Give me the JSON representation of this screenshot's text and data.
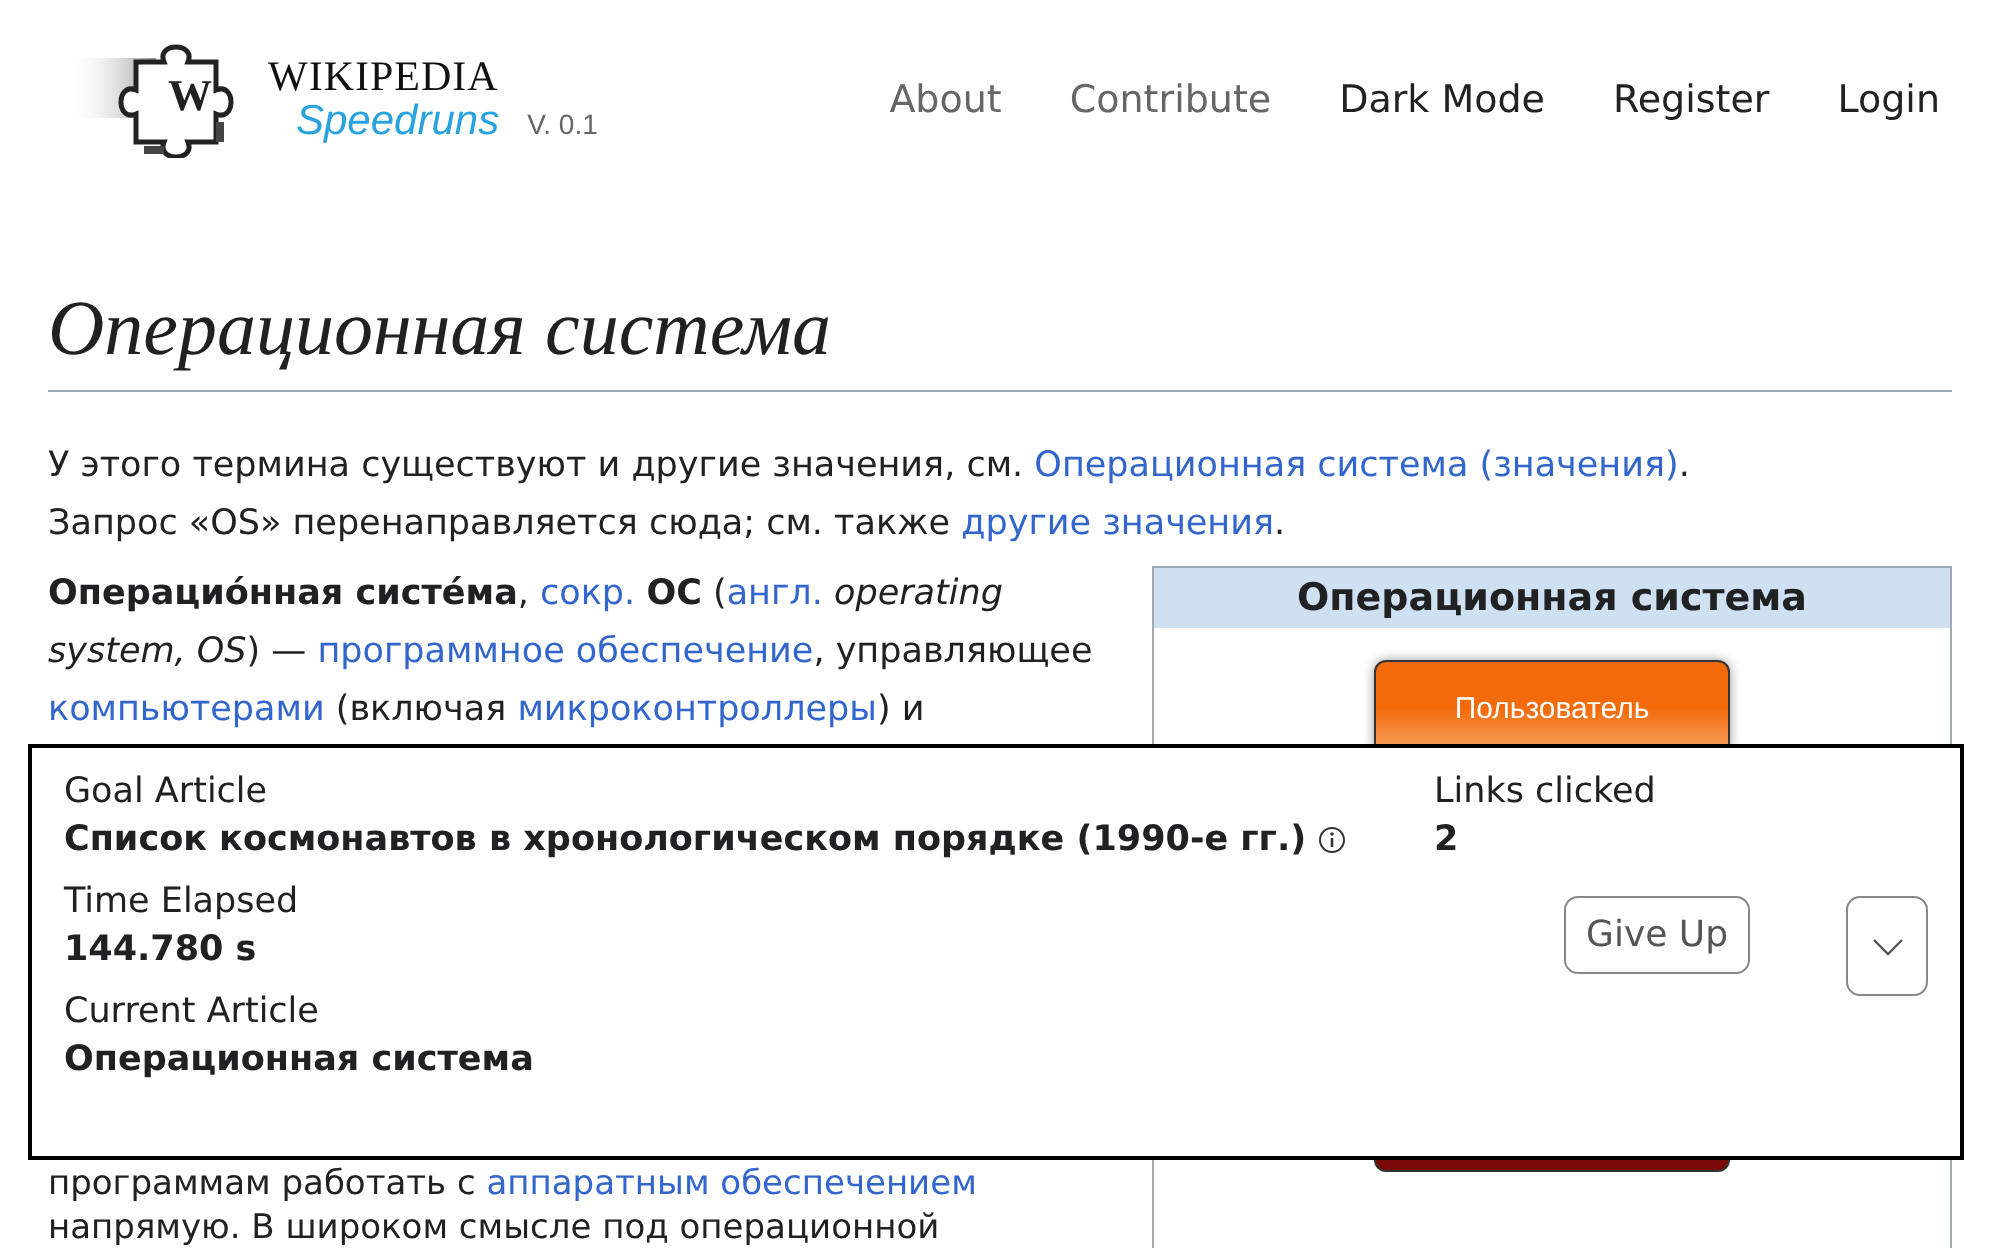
{
  "logo": {
    "mark": "W",
    "name": "WIKIPEDIA",
    "subtitle": "Speedruns",
    "version": "V. 0.1"
  },
  "nav": [
    {
      "label": "About",
      "kind": "page"
    },
    {
      "label": "Contribute",
      "kind": "page"
    },
    {
      "label": "Dark Mode",
      "kind": "action"
    },
    {
      "label": "Register",
      "kind": "action"
    },
    {
      "label": "Login",
      "kind": "action"
    }
  ],
  "article": {
    "title": "Операционная система",
    "hatnotes": [
      [
        {
          "kind": "text",
          "text": "У этого термина существуют и другие значения, см. "
        },
        {
          "kind": "link",
          "text": "Операционная система (значения)"
        },
        {
          "kind": "text",
          "text": "."
        }
      ],
      [
        {
          "kind": "text",
          "text": "Запрос «OS» перенаправляется сюда; см. также "
        },
        {
          "kind": "link",
          "text": "другие значения"
        },
        {
          "kind": "text",
          "text": "."
        }
      ]
    ],
    "lead_lines": [
      [
        {
          "kind": "text",
          "text": "**Операцио́нная систе́ма**, "
        },
        {
          "kind": "link",
          "text": "сокр."
        },
        {
          "kind": "text",
          "text": " **ОС** ("
        },
        {
          "kind": "link",
          "text": "англ."
        },
        {
          "kind": "text",
          "text": " *operating*"
        }
      ],
      [
        {
          "kind": "text",
          "text": "*system, OS*) — "
        },
        {
          "kind": "link",
          "text": "программное обеспечение"
        },
        {
          "kind": "text",
          "text": ", управляющее"
        }
      ],
      [
        {
          "kind": "link",
          "text": "компьютерами"
        },
        {
          "kind": "text",
          "text": " (включая "
        },
        {
          "kind": "link",
          "text": "микроконтроллеры"
        },
        {
          "kind": "text",
          "text": ") и"
        }
      ]
    ],
    "tail_lines": [
      [
        {
          "kind": "text",
          "text": "программам работать с "
        },
        {
          "kind": "link",
          "text": "аппаратным обеспечением"
        }
      ],
      [
        {
          "kind": "text",
          "text": "напрямую. В широком смысле под операционной"
        }
      ]
    ],
    "infobox": {
      "title": "Операционная система",
      "diagram": [
        {
          "label": "Пользователь",
          "color": "#f26a0a"
        },
        {
          "color": "#7a0a0a"
        }
      ]
    }
  },
  "game_panel": {
    "goal_label": "Goal Article",
    "goal_value": "Список космонавтов в хронологическом порядке (1990-е гг.)",
    "links_label": "Links clicked",
    "links_value": "2",
    "time_label": "Time Elapsed",
    "time_value": "144.780 s",
    "current_label": "Current Article",
    "current_value": "Операционная система",
    "give_up": "Give Up",
    "expanded": false
  }
}
